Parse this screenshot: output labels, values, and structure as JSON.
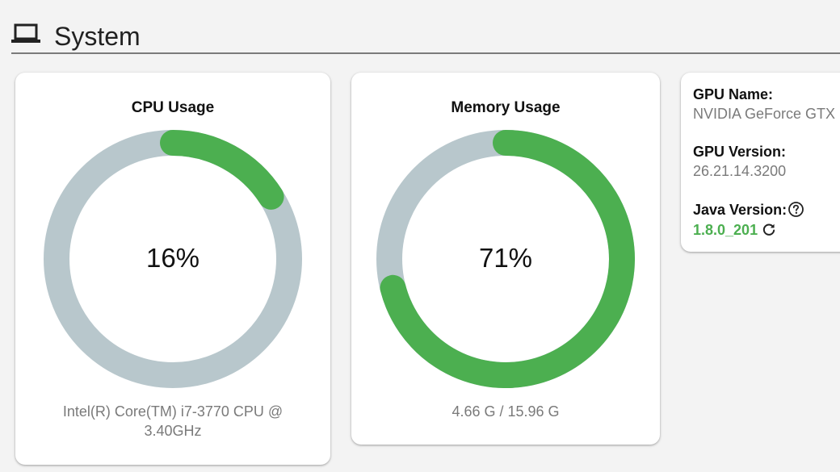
{
  "header": {
    "icon": "laptop-icon",
    "title": "System"
  },
  "cpu": {
    "title": "CPU Usage",
    "percent": 16,
    "value_label": "16%",
    "subtitle": "Intel(R) Core(TM) i7-3770 CPU @ 3.40GHz"
  },
  "memory": {
    "title": "Memory Usage",
    "percent": 71,
    "value_label": "71%",
    "subtitle": "4.66 G / 15.96 G"
  },
  "gpu": {
    "name_label": "GPU Name:",
    "name_value": "NVIDIA GeForce GTX",
    "version_label": "GPU Version:",
    "version_value": "26.21.14.3200",
    "java_label": "Java Version:",
    "java_value": "1.8.0_201",
    "help_icon": "help-circle-icon",
    "refresh_icon": "refresh-icon"
  },
  "colors": {
    "gauge_fill": "#4caf50",
    "gauge_track": "#b8c7cc",
    "header_rule": "#7a7a7a",
    "java_version": "#4caf50"
  }
}
